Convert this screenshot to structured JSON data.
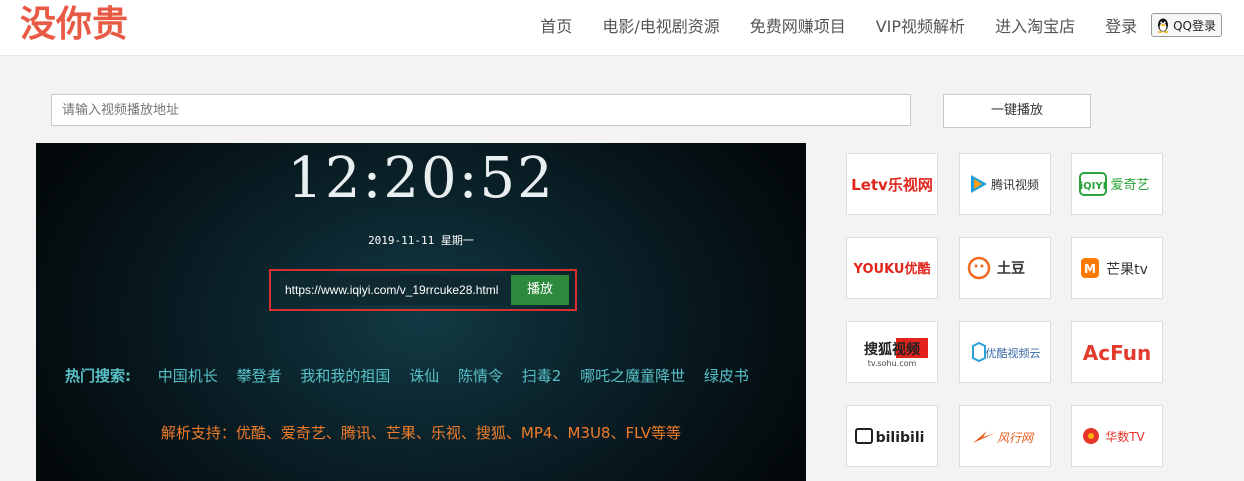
{
  "header": {
    "logo_text": "没你贵",
    "nav": [
      {
        "label": "首页"
      },
      {
        "label": "电影/电视剧资源"
      },
      {
        "label": "免费网赚项目"
      },
      {
        "label": "VIP视频解析"
      },
      {
        "label": "进入淘宝店"
      }
    ],
    "login_label": "登录",
    "qq_login_label": "QQ登录"
  },
  "search": {
    "placeholder": "请输入视频播放地址",
    "button_label": "一键播放"
  },
  "player": {
    "clock": "12:20:52",
    "date": "2019-11-11 星期一",
    "url_value": "https://www.iqiyi.com/v_19rrcuke28.html",
    "play_label": "播放",
    "hot_label": "热门搜索:",
    "hot_items": [
      "中国机长",
      "攀登者",
      "我和我的祖国",
      "诛仙",
      "陈情令",
      "扫毒2",
      "哪吒之魔童降世",
      "绿皮书"
    ],
    "support_text": "解析支持：优酷、爱奇艺、腾讯、芒果、乐视、搜狐、MP4、M3U8、FLV等等"
  },
  "platforms": [
    {
      "icon": "letv-logo",
      "text": "Letv乐视网"
    },
    {
      "icon": "tencent-video-logo",
      "text": "腾讯视频"
    },
    {
      "icon": "iqiyi-logo",
      "text": "爱奇艺"
    },
    {
      "icon": "youku-logo",
      "text": "YOUKU优酷"
    },
    {
      "icon": "tudou-logo",
      "text": "土豆"
    },
    {
      "icon": "mgtv-logo",
      "text": "芒果tv"
    },
    {
      "icon": "sohu-logo",
      "text": "搜狐视频"
    },
    {
      "icon": "youku-cloud-logo",
      "text": "优酷视频云"
    },
    {
      "icon": "acfun-logo",
      "text": "AcFun"
    },
    {
      "icon": "bilibili-logo",
      "text": "bilibili"
    },
    {
      "icon": "funshion-logo",
      "text": "风行网"
    },
    {
      "icon": "huashu-logo",
      "text": "华数TV"
    }
  ],
  "colors": {
    "accent_red": "#d8302f",
    "play_green": "#2c8a3d",
    "hot_teal": "#58c0c7",
    "support_orange": "#f07c2a"
  }
}
